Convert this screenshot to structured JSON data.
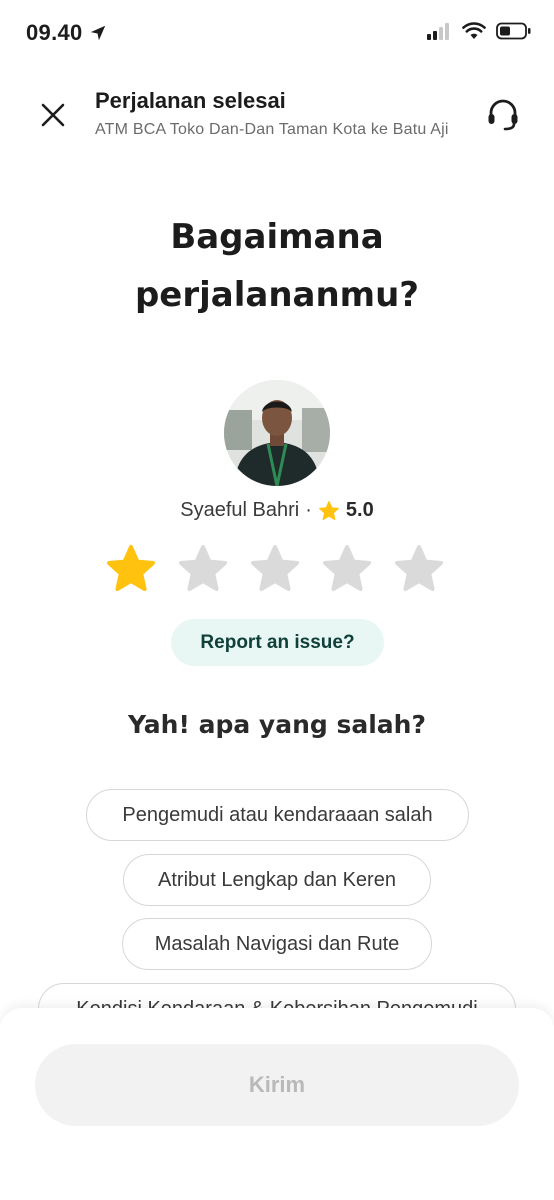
{
  "status_bar": {
    "time": "09.40",
    "location_icon": "location-arrow-icon",
    "signal_icon": "cellular-signal-icon",
    "wifi_icon": "wifi-icon",
    "battery_icon": "battery-icon"
  },
  "header": {
    "title": "Perjalanan selesai",
    "subtitle": "ATM BCA Toko Dan-Dan Taman Kota ke Batu Aji",
    "close_icon": "close-icon",
    "support_icon": "headset-icon"
  },
  "question": {
    "line1": "Bagaimana",
    "line2": "perjalananmu?"
  },
  "driver": {
    "name": "Syaeful Bahri",
    "separator": "·",
    "rating": "5.0",
    "rating_icon": "star-icon",
    "avatar_icon": "driver-avatar"
  },
  "rating": {
    "selected": 1,
    "max": 5,
    "active_color": "#ffc20e",
    "inactive_color": "#dadada"
  },
  "report_issue": {
    "label": "Report an issue?"
  },
  "feedback": {
    "heading": "Yah! apa yang salah?",
    "options": [
      "Pengemudi atau kendaraaan salah",
      "Atribut Lengkap dan Keren",
      "Masalah Navigasi dan Rute",
      "Kondisi Kendaraan & Kebersihan Pengemudi"
    ]
  },
  "submit": {
    "label": "Kirim"
  },
  "colors": {
    "accent_teal_bg": "#e9f7f4",
    "accent_teal_text": "#10403a",
    "disabled_bg": "#f2f2f2",
    "disabled_text": "#b9b9b9"
  }
}
